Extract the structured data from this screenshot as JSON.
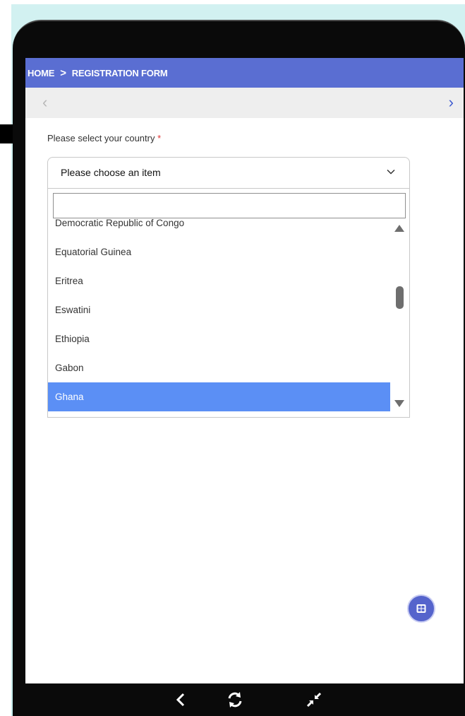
{
  "breadcrumb": {
    "home": "HOME",
    "separator": ">",
    "current": "REGISTRATION FORM"
  },
  "nav": {
    "prev": "‹",
    "next": "›"
  },
  "form": {
    "country_label": "Please select your country",
    "required_mark": "*",
    "select_value": "Please choose an item"
  },
  "dropdown": {
    "search_value": "",
    "items": [
      {
        "label": "Democratic Republic of Congo",
        "selected": false
      },
      {
        "label": "Equatorial Guinea",
        "selected": false
      },
      {
        "label": "Eritrea",
        "selected": false
      },
      {
        "label": "Eswatini",
        "selected": false
      },
      {
        "label": "Ethiopia",
        "selected": false
      },
      {
        "label": "Gabon",
        "selected": false
      },
      {
        "label": "Ghana",
        "selected": true
      }
    ]
  },
  "colors": {
    "header": "#5a6ed2",
    "selected": "#5b8ff5",
    "fab": "#5564cc",
    "required": "#e03333"
  },
  "icons": {
    "chevron": "chevron-down-icon",
    "fab": "grid-icon",
    "back": "back-icon",
    "refresh": "refresh-icon",
    "collapse": "collapse-icon"
  }
}
